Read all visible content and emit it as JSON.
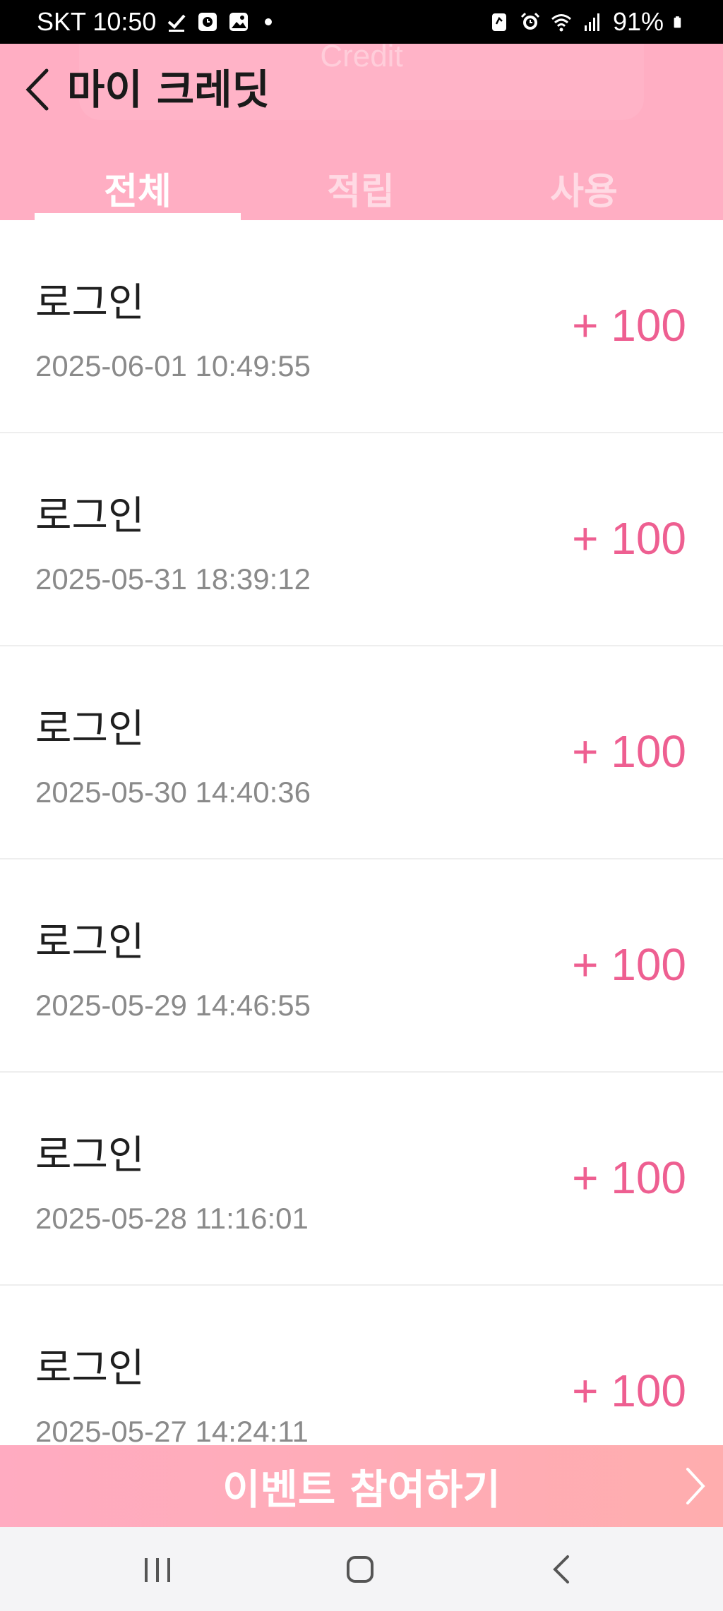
{
  "status_bar": {
    "carrier_time": "SKT 10:50",
    "battery": "91%",
    "icons_left": [
      "check-icon",
      "clock-app-icon",
      "gallery-icon",
      "dot-icon"
    ],
    "icons_right": [
      "battery-saver-icon",
      "alarm-icon",
      "wifi-icon",
      "signal-icon",
      "battery-icon"
    ]
  },
  "header": {
    "ghost_text": "Credit",
    "title": "마이 크레딧",
    "tabs": [
      {
        "label": "전체",
        "active": true
      },
      {
        "label": "적립",
        "active": false
      },
      {
        "label": "사용",
        "active": false
      }
    ]
  },
  "transactions": [
    {
      "title": "로그인",
      "date": "2025-06-01 10:49:55",
      "amount": "+ 100"
    },
    {
      "title": "로그인",
      "date": "2025-05-31 18:39:12",
      "amount": "+ 100"
    },
    {
      "title": "로그인",
      "date": "2025-05-30 14:40:36",
      "amount": "+ 100"
    },
    {
      "title": "로그인",
      "date": "2025-05-29 14:46:55",
      "amount": "+ 100"
    },
    {
      "title": "로그인",
      "date": "2025-05-28 11:16:01",
      "amount": "+ 100"
    },
    {
      "title": "로그인",
      "date": "2025-05-27 14:24:11",
      "amount": "+ 100"
    }
  ],
  "event_banner": {
    "label": "이벤트 참여하기"
  },
  "colors": {
    "header_bg": "#ffaec3",
    "amount": "#ee5f91",
    "banner": "#ffabc1"
  }
}
